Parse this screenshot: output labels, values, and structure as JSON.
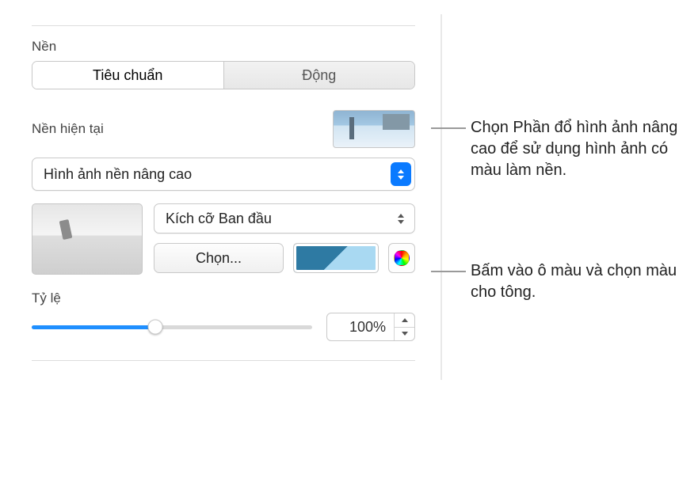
{
  "section": {
    "background": "Nền"
  },
  "tabs": {
    "standard": "Tiêu chuẩn",
    "dynamic": "Động"
  },
  "current": {
    "label": "Nền hiện tại"
  },
  "fillType": {
    "selected": "Hình ảnh nền nâng cao"
  },
  "sizeMode": {
    "selected": "Kích cỡ Ban đầu"
  },
  "choose": {
    "label": "Chọn..."
  },
  "scale": {
    "label": "Tỷ lệ",
    "value": "100%"
  },
  "callouts": {
    "fill": "Chọn Phần đổ hình ảnh nâng cao để sử dụng hình ảnh có màu làm nền.",
    "color": "Bấm vào ô màu và chọn màu cho tông."
  }
}
